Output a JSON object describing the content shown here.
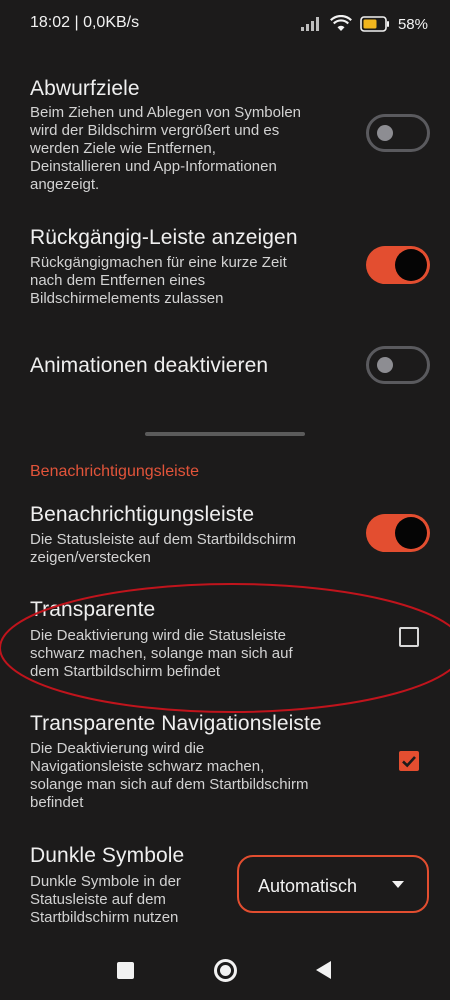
{
  "status_bar": {
    "time_speed": "18:02 | 0,0KB/s",
    "battery": "58%"
  },
  "settings": {
    "drop_targets": {
      "title": "Abwurfziele",
      "desc": [
        "Beim Ziehen und Ablegen von Symbolen",
        "wird der Bildschirm vergrößert und es",
        "werden Ziele wie Entfernen,",
        "Deinstallieren und App-Informationen",
        "angezeigt."
      ],
      "state": "off"
    },
    "undo_bar": {
      "title": "Rückgängig-Leiste anzeigen",
      "desc": [
        "Rückgängigmachen für eine kurze Zeit",
        "nach dem Entfernen eines",
        "Bildschirmelements zulassen"
      ],
      "state": "on"
    },
    "disable_animations": {
      "title": "Animationen deaktivieren",
      "state": "off"
    }
  },
  "notification_section": {
    "header": "Benachrichtigungsleiste",
    "status_bar_toggle": {
      "title": "Benachrichtigungsleiste",
      "desc": [
        "Die Statusleiste auf dem Startbildschirm",
        "zeigen/verstecken"
      ],
      "state": "on"
    },
    "transparent": {
      "title": "Transparente",
      "desc": [
        "Die Deaktivierung wird die Statusleiste",
        "schwarz machen, solange man sich auf",
        "dem Startbildschirm befindet"
      ],
      "checked": false
    },
    "transparent_nav": {
      "title": "Transparente Navigationsleiste",
      "desc": [
        "Die Deaktivierung wird die",
        "Navigationsleiste schwarz machen,",
        "solange man sich auf dem Startbildschirm",
        "befindet"
      ],
      "checked": true
    },
    "dark_icons": {
      "title": "Dunkle Symbole",
      "desc": [
        "Dunkle Symbole in der",
        "Statusleiste auf dem",
        "Startbildschirm nutzen"
      ],
      "selected": "Automatisch"
    }
  },
  "colors": {
    "accent": "#e34e30",
    "background": "#1c1b1b",
    "annotation": "#c0141c"
  },
  "icons": [
    "signal-icon",
    "wifi-icon",
    "battery-icon",
    "checkmark-icon",
    "chevron-down-icon",
    "recents-icon",
    "home-icon",
    "back-icon"
  ]
}
